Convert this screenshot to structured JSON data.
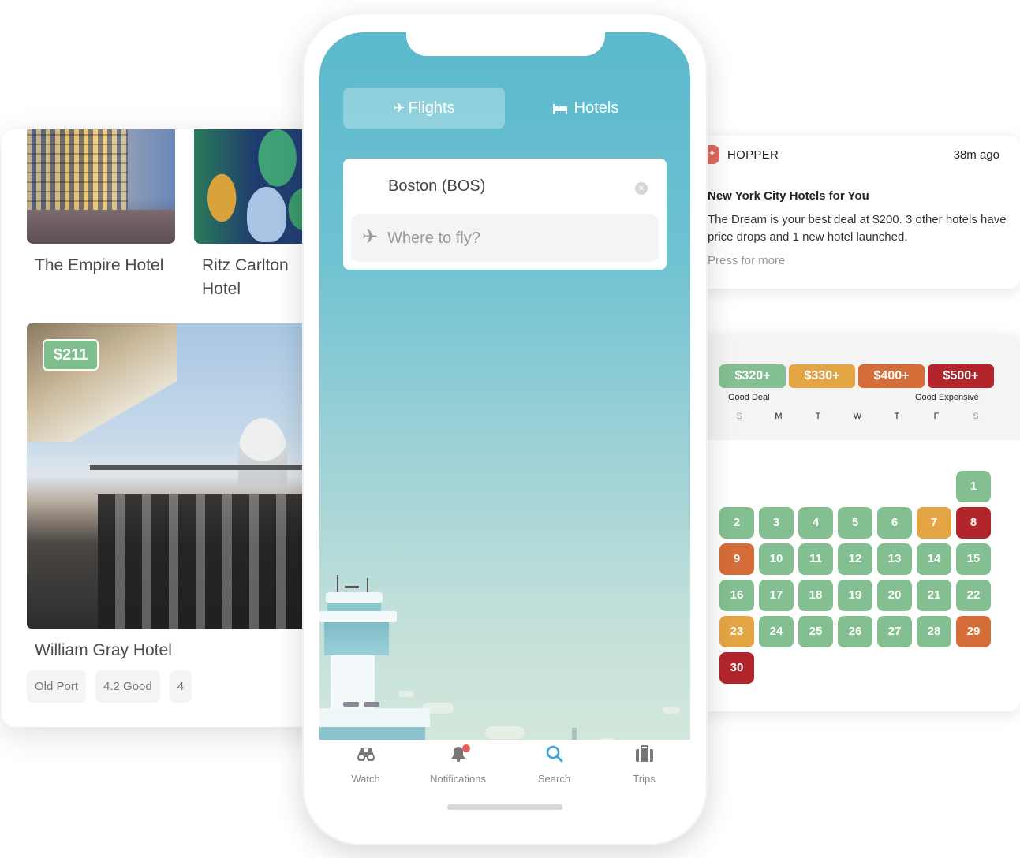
{
  "hotels": {
    "cards": [
      {
        "name": "The Empire Hotel"
      },
      {
        "name": "Ritz Carlton Hotel"
      }
    ],
    "featured": {
      "name": "William Gray Hotel",
      "price": "$211",
      "tags": [
        "Old Port",
        "4.2 Good",
        "4"
      ]
    }
  },
  "phone": {
    "tabs": [
      {
        "label": "Flights",
        "icon": "airplane-icon",
        "active": true
      },
      {
        "label": "Hotels",
        "icon": "bed-icon",
        "active": false
      }
    ],
    "search": {
      "origin": "Boston (BOS)",
      "destination_value": "",
      "destination_placeholder": "Where to fly?"
    },
    "tabbar": [
      {
        "label": "Watch",
        "icon": "binoculars-icon"
      },
      {
        "label": "Notifications",
        "icon": "bell-icon",
        "badge": true
      },
      {
        "label": "Search",
        "icon": "search-icon",
        "active": true
      },
      {
        "label": "Trips",
        "icon": "suitcase-icon"
      }
    ]
  },
  "notification": {
    "app": "HOPPER",
    "time": "38m ago",
    "title": "New York City Hotels for You",
    "body": "The Dream is your best deal at $200. 3 other hotels have price drops and 1 new hotel launched.",
    "more": "Press for more"
  },
  "calendar": {
    "legend": [
      {
        "label": "$320+",
        "level": "good"
      },
      {
        "label": "$330+",
        "level": "fair"
      },
      {
        "label": "$400+",
        "level": "high"
      },
      {
        "label": "$500+",
        "level": "expensive"
      }
    ],
    "legend_low": "Good Deal",
    "legend_high": "Good Expensive",
    "weekdays": [
      "S",
      "M",
      "T",
      "W",
      "T",
      "F",
      "S"
    ],
    "leading_blanks": 6,
    "days": [
      {
        "d": "1",
        "level": "good"
      },
      {
        "d": "2",
        "level": "good"
      },
      {
        "d": "3",
        "level": "good"
      },
      {
        "d": "4",
        "level": "good"
      },
      {
        "d": "5",
        "level": "good"
      },
      {
        "d": "6",
        "level": "good"
      },
      {
        "d": "7",
        "level": "fair"
      },
      {
        "d": "8",
        "level": "expensive"
      },
      {
        "d": "9",
        "level": "high"
      },
      {
        "d": "10",
        "level": "good"
      },
      {
        "d": "11",
        "level": "good"
      },
      {
        "d": "12",
        "level": "good"
      },
      {
        "d": "13",
        "level": "good"
      },
      {
        "d": "14",
        "level": "good"
      },
      {
        "d": "15",
        "level": "good"
      },
      {
        "d": "16",
        "level": "good"
      },
      {
        "d": "17",
        "level": "good"
      },
      {
        "d": "18",
        "level": "good"
      },
      {
        "d": "19",
        "level": "good"
      },
      {
        "d": "20",
        "level": "good"
      },
      {
        "d": "21",
        "level": "good"
      },
      {
        "d": "22",
        "level": "good"
      },
      {
        "d": "23",
        "level": "fair"
      },
      {
        "d": "24",
        "level": "good"
      },
      {
        "d": "25",
        "level": "good"
      },
      {
        "d": "26",
        "level": "good"
      },
      {
        "d": "27",
        "level": "good"
      },
      {
        "d": "28",
        "level": "good"
      },
      {
        "d": "29",
        "level": "high"
      },
      {
        "d": "30",
        "level": "expensive"
      }
    ],
    "colors": {
      "good": "#83bf91",
      "fair": "#e5a444",
      "high": "#d56d38",
      "expensive": "#b2262b"
    }
  },
  "colors": {
    "accent": "#3aa3dc",
    "sky_top": "#5ab9cc",
    "badge": "#e9605a",
    "price_badge": "#7fbf8d"
  }
}
